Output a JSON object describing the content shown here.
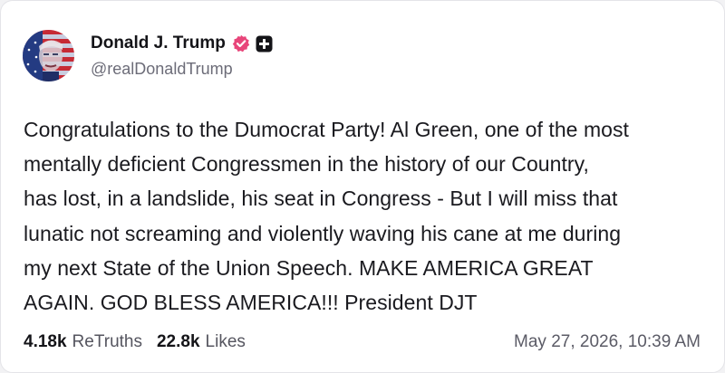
{
  "post": {
    "author": {
      "display_name": "Donald J. Trump",
      "handle": "@realDonaldTrump",
      "verified_icon": "verified-badge-icon",
      "plus_icon": "plus-square-icon"
    },
    "text": "Congratulations to the Dumocrat Party! Al Green, one of the most\nmentally deficient Congressmen in the history of our Country,\nhas lost, in a landslide, his seat in Congress - But I will miss that\nlunatic not screaming and violently waving his cane at me during\nmy next State of the Union Speech. MAKE AMERICA GREAT\nAGAIN. GOD BLESS AMERICA!!! President DJT",
    "stats": {
      "retruths_count": "4.18k",
      "retruths_label": "ReTruths",
      "likes_count": "22.8k",
      "likes_label": "Likes"
    },
    "timestamp": "May 27, 2026, 10:39 AM"
  },
  "colors": {
    "verified_badge": "#e8457a",
    "plus_badge": "#141418",
    "text": "#1a1a1f",
    "muted": "#6c6c78"
  }
}
